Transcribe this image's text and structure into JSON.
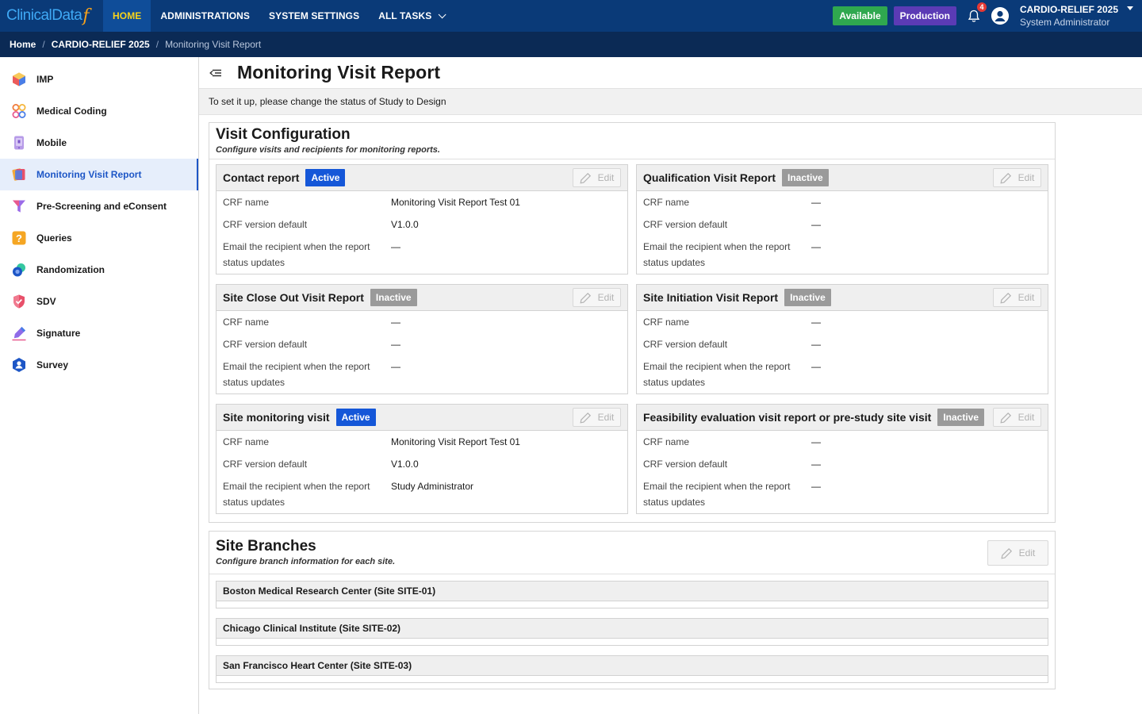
{
  "brand": {
    "name": "ClinicalData",
    "mark": "f"
  },
  "nav": {
    "items": [
      "HOME",
      "ADMINISTRATIONS",
      "SYSTEM SETTINGS",
      "ALL TASKS"
    ]
  },
  "status": {
    "availability": "Available",
    "environment": "Production"
  },
  "notifications": {
    "count": "4"
  },
  "user": {
    "org": "CARDIO-RELIEF 2025",
    "role": "System Administrator"
  },
  "breadcrumb": {
    "home": "Home",
    "study": "CARDIO-RELIEF 2025",
    "current": "Monitoring Visit Report"
  },
  "sidebar": {
    "items": [
      {
        "label": "IMP",
        "icon": "cube-icon"
      },
      {
        "label": "Medical Coding",
        "icon": "coding-icon"
      },
      {
        "label": "Mobile",
        "icon": "mobile-icon"
      },
      {
        "label": "Monitoring Visit Report",
        "icon": "report-icon",
        "active": true
      },
      {
        "label": "Pre-Screening and eConsent",
        "icon": "funnel-icon"
      },
      {
        "label": "Queries",
        "icon": "question-icon"
      },
      {
        "label": "Randomization",
        "icon": "randomization-icon"
      },
      {
        "label": "SDV",
        "icon": "shield-icon"
      },
      {
        "label": "Signature",
        "icon": "pen-icon"
      },
      {
        "label": "Survey",
        "icon": "survey-icon"
      }
    ]
  },
  "page": {
    "title": "Monitoring Visit Report",
    "notice": "To set it up, please change the status of Study to Design"
  },
  "visit_config": {
    "title": "Visit Configuration",
    "subtitle": "Configure visits and recipients for monitoring reports.",
    "edit_label": "Edit",
    "field_labels": {
      "crf_name": "CRF name",
      "crf_version": "CRF version default",
      "email_line1": "Email the recipient when the report",
      "email_line2": "status updates"
    },
    "cards": [
      {
        "title": "Contact report",
        "status": "Active",
        "crf_name": "Monitoring Visit Report Test 01",
        "crf_version": "V1.0.0",
        "email": "—"
      },
      {
        "title": "Qualification Visit Report",
        "status": "Inactive",
        "crf_name": "—",
        "crf_version": "—",
        "email": "—"
      },
      {
        "title": "Site Close Out Visit Report",
        "status": "Inactive",
        "crf_name": "—",
        "crf_version": "—",
        "email": "—"
      },
      {
        "title": "Site Initiation Visit Report",
        "status": "Inactive",
        "crf_name": "—",
        "crf_version": "—",
        "email": "—"
      },
      {
        "title": "Site monitoring visit",
        "status": "Active",
        "crf_name": "Monitoring Visit Report Test 01",
        "crf_version": "V1.0.0",
        "email": "Study Administrator"
      },
      {
        "title": "Feasibility evaluation visit report or pre-study site visit",
        "status": "Inactive",
        "crf_name": "—",
        "crf_version": "—",
        "email": "—"
      }
    ]
  },
  "site_branches": {
    "title": "Site Branches",
    "subtitle": "Configure branch information for each site.",
    "edit_label": "Edit",
    "sites": [
      "Boston Medical Research Center (Site SITE-01)",
      "Chicago Clinical Institute (Site SITE-02)",
      "San Francisco Heart Center (Site SITE-03)"
    ]
  }
}
